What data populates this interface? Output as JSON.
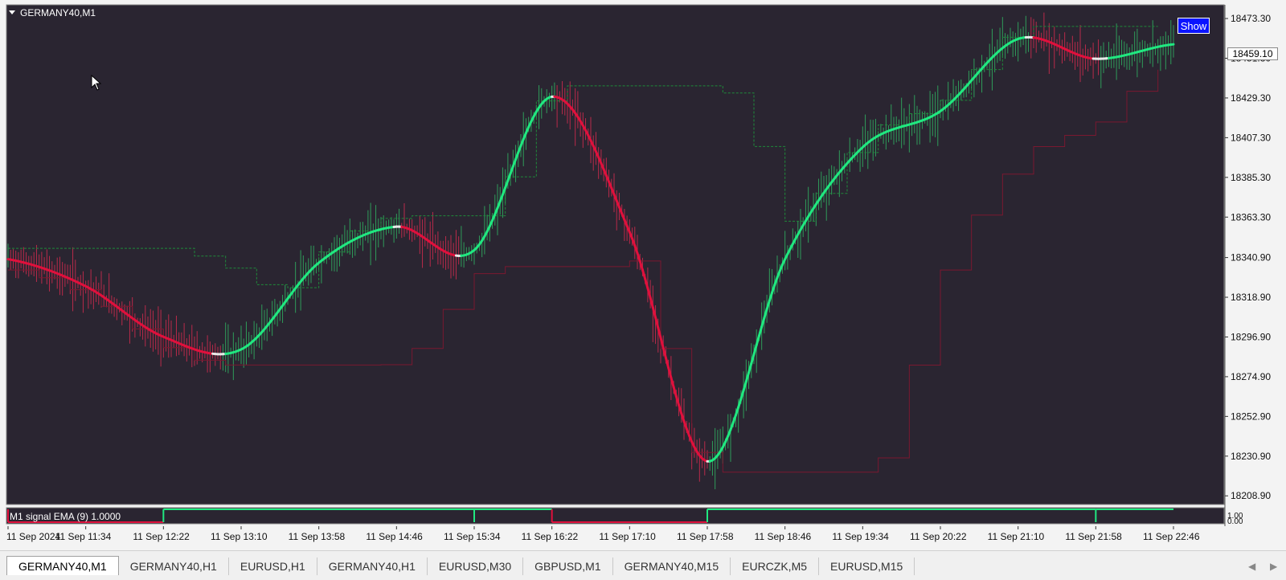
{
  "chart": {
    "title": "GERMANY40,M1",
    "show_button": "Show",
    "current_price": "18459.10",
    "indicator_label": "M1 signal EMA (9) 1.0000",
    "indicator_right_a": "1.00",
    "indicator_right_b": "0.00",
    "price_ticks": [
      "18473.30",
      "18451.30",
      "18429.30",
      "18407.30",
      "18385.30",
      "18363.30",
      "18340.90",
      "18318.90",
      "18296.90",
      "18274.90",
      "18252.90",
      "18230.90",
      "18208.90"
    ],
    "time_ticks": [
      "11 Sep 2024",
      "11 Sep 11:34",
      "11 Sep 12:22",
      "11 Sep 13:10",
      "11 Sep 13:58",
      "11 Sep 14:46",
      "11 Sep 15:34",
      "11 Sep 16:22",
      "11 Sep 17:10",
      "11 Sep 17:58",
      "11 Sep 18:46",
      "11 Sep 19:34",
      "11 Sep 20:22",
      "11 Sep 21:10",
      "11 Sep 21:58",
      "11 Sep 22:46"
    ],
    "colors": {
      "background": "#2a2531",
      "bull": "#20e880",
      "bear": "#e0103c",
      "neutral": "#e8e8e8",
      "upper_band": "#1e8a3a",
      "lower_band": "#7a1830"
    }
  },
  "chart_data": {
    "type": "line",
    "symbol": "GERMANY40",
    "timeframe": "M1",
    "ylim": [
      18205,
      18480
    ],
    "x": [
      "11 Sep 2024",
      "11 Sep 11:34",
      "11 Sep 12:22",
      "11 Sep 13:10",
      "11 Sep 13:58",
      "11 Sep 14:46",
      "11 Sep 15:34",
      "11 Sep 16:22",
      "11 Sep 17:10",
      "11 Sep 17:58",
      "11 Sep 18:46",
      "11 Sep 19:34",
      "11 Sep 20:22",
      "11 Sep 21:10",
      "11 Sep 21:58",
      "11 Sep 22:46"
    ],
    "series": [
      {
        "values": [
          18340,
          18325,
          18297,
          18290,
          18338,
          18358,
          18345,
          18430,
          18355,
          18228,
          18340,
          18402,
          18422,
          18462,
          18451,
          18459
        ]
      }
    ],
    "signal": [
      {
        "from": "11 Sep 2024",
        "to": "11 Sep 12:22",
        "state": "bear"
      },
      {
        "from": "11 Sep 12:22",
        "to": "11 Sep 15:34",
        "state": "bull"
      },
      {
        "from": "11 Sep 15:34",
        "to": "11 Sep 16:22",
        "state": "bull"
      },
      {
        "from": "11 Sep 16:22",
        "to": "11 Sep 17:58",
        "state": "bear"
      },
      {
        "from": "11 Sep 17:58",
        "to": "11 Sep 21:58",
        "state": "bull"
      },
      {
        "from": "11 Sep 21:58",
        "to": "11 Sep 22:46",
        "state": "bull"
      }
    ]
  },
  "tabs": [
    {
      "label": "GERMANY40,M1",
      "active": true
    },
    {
      "label": "GERMANY40,H1",
      "active": false
    },
    {
      "label": "EURUSD,H1",
      "active": false
    },
    {
      "label": "GERMANY40,H1",
      "active": false
    },
    {
      "label": "EURUSD,M30",
      "active": false
    },
    {
      "label": "GBPUSD,M1",
      "active": false
    },
    {
      "label": "GERMANY40,M15",
      "active": false
    },
    {
      "label": "EURCZK,M5",
      "active": false
    },
    {
      "label": "EURUSD,M15",
      "active": false
    }
  ],
  "tabbar": {
    "left_arrow": "◀",
    "right_arrow": "▶"
  }
}
